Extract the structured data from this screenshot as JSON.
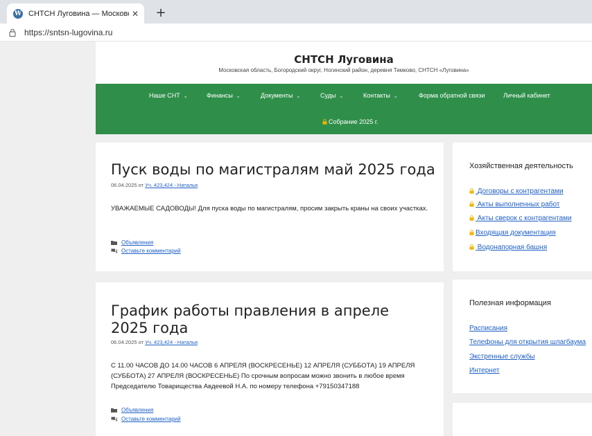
{
  "browser": {
    "tab_title": "СНТСН Луговина — Московская о",
    "tab_favicon": "W",
    "url": "https://sntsn-lugovina.ru"
  },
  "site": {
    "title": "СНТСН Луговина",
    "description": "Московская область, Богородский округ, Ногинский район, деревня Тимково, СНТСН «Луговина»"
  },
  "nav": {
    "items": [
      {
        "label": "Наше СНТ"
      },
      {
        "label": "Финансы"
      },
      {
        "label": "Документы"
      },
      {
        "label": "Суды"
      },
      {
        "label": "Контакты"
      },
      {
        "label": "Форма обратной связи"
      },
      {
        "label": "Личный кабинет"
      }
    ],
    "second_row_label": "Собрание 2025 г."
  },
  "posts": [
    {
      "title": "Пуск воды по магистралям май 2025 года",
      "date": "06.04.2025",
      "by": "от",
      "author": "Уч. 423,424 - Наталья",
      "body": "УВАЖАЕМЫЕ САДОВОДЫ!   Для пуска воды по магистралям, просим закрыть краны на своих участках.",
      "category": "Объявления",
      "comment_link": "Оставьте комментарий"
    },
    {
      "title": "График работы правления в апреле 2025 года",
      "date": "06.04.2025",
      "by": "от",
      "author": "Уч. 423,424 - Наталья",
      "body": "С 11.00 ЧАСОВ ДО 14.00 ЧАСОВ 6 АПРЕЛЯ (ВОСКРЕСЕНЬЕ) 12 АПРЕЛЯ (СУББОТА) 19 АПРЕЛЯ (СУББОТА) 27 АПРЕЛЯ (ВОСКРЕСЕНЬЕ) По срочным вопросам можно звонить в любое время Председателю Товарищества Авдеевой Н.А. по номеру телефона +79150347188",
      "category": "Объявления",
      "comment_link": "Оставьте комментарий"
    }
  ],
  "sidebar": {
    "widget1": {
      "title": "Хозяйственная деятельность",
      "links": [
        "Договоры с контрагентами",
        "Акты выполненных работ",
        "Акты сверок с контрагентами",
        "Входящая документация",
        "Водонапорная башня"
      ]
    },
    "widget2": {
      "title": "Полезная информация",
      "links": [
        "Расписания",
        "Телефоны для открытия шлагбаума",
        "Экстренные службы",
        "Интернет"
      ]
    }
  },
  "colors": {
    "nav_bg": "#2f8f4a",
    "link": "#1e5fc4",
    "lock_gold": "#f2b400",
    "page_bg": "#efefef"
  }
}
